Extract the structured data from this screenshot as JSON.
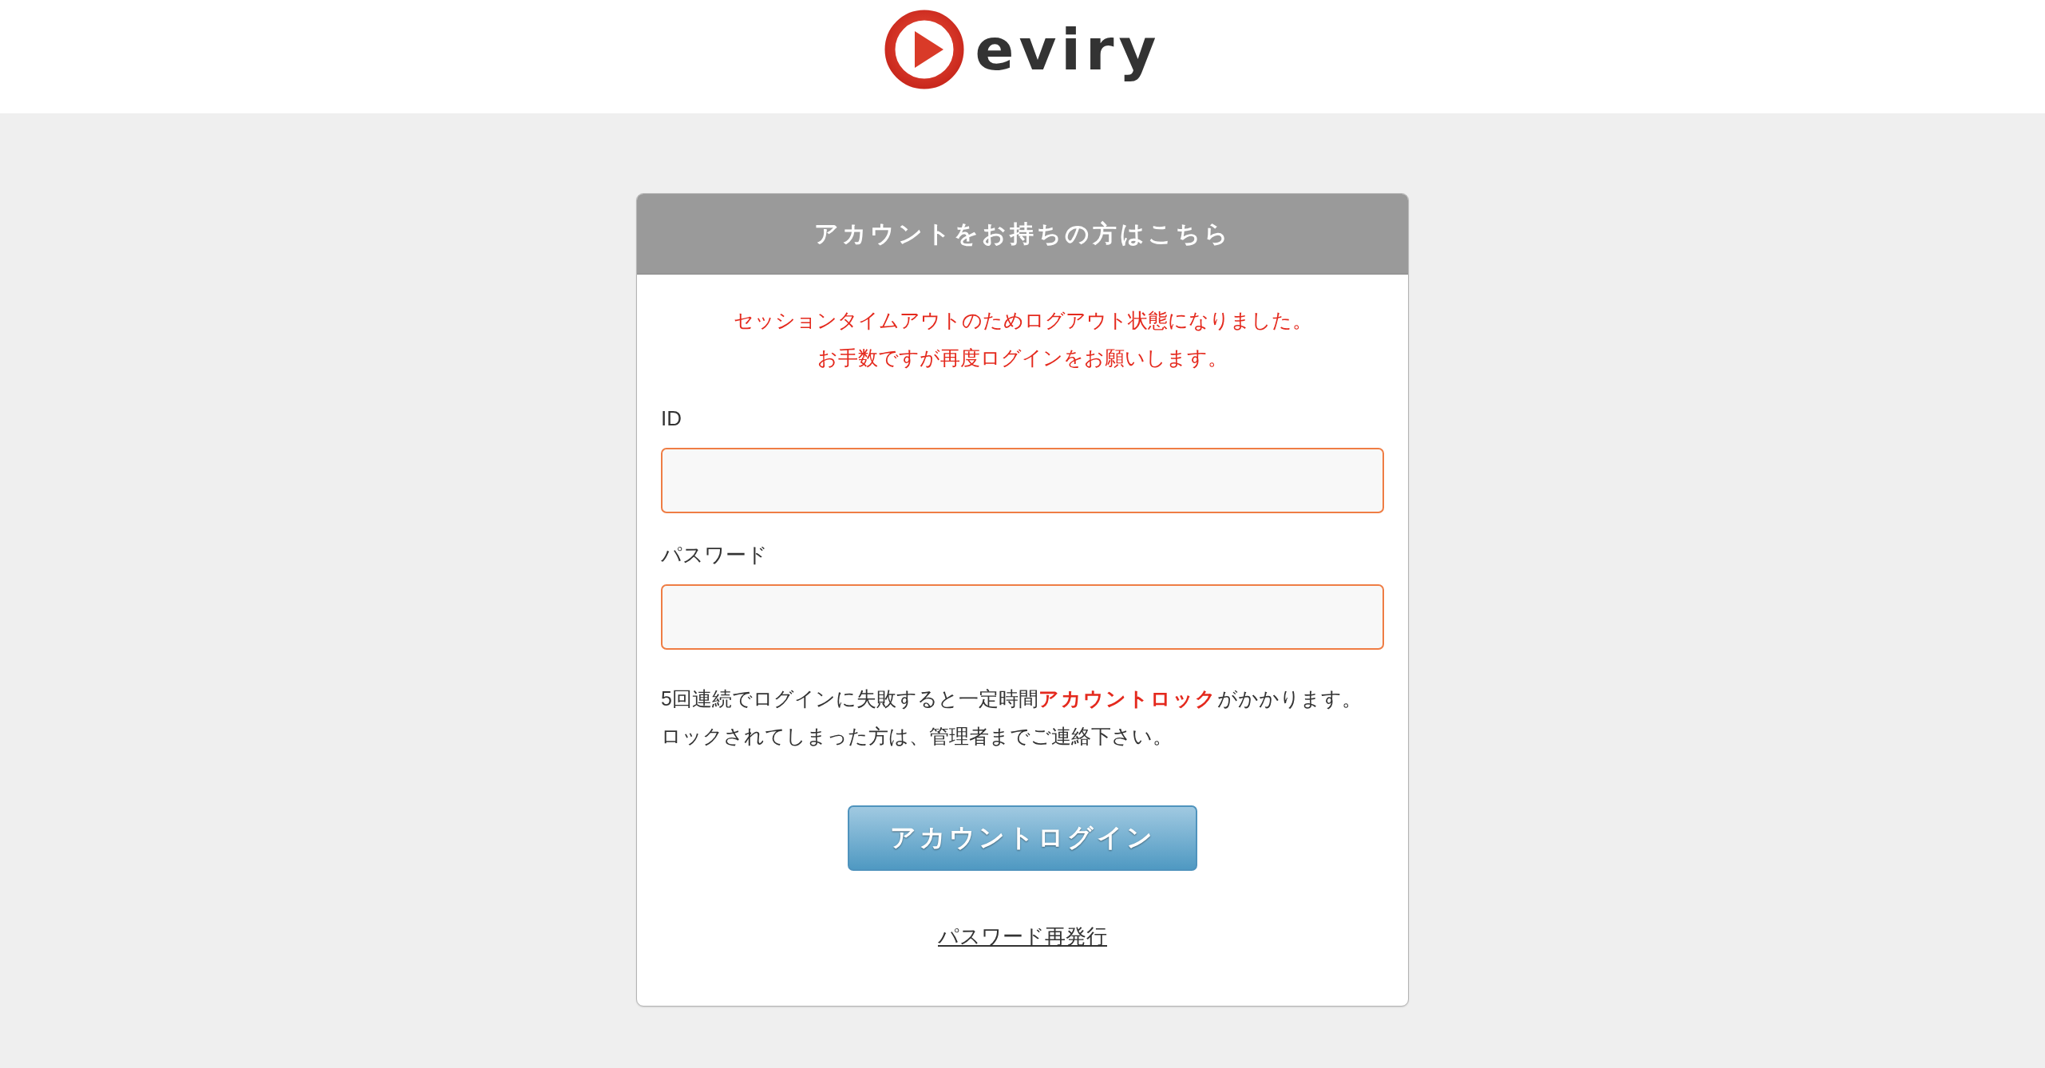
{
  "header": {
    "logo_text": "eviry"
  },
  "login_card": {
    "title": "アカウントをお持ちの方はこちら",
    "alert_lines": [
      "セッションタイムアウトのためログアウト状態になりました。",
      "お手数ですが再度ログインをお願いします。"
    ],
    "fields": [
      {
        "label": "ID"
      },
      {
        "label": "パスワード"
      }
    ],
    "notice_lines": [
      "5回連続でログインに失敗すると一定時間**アカウントロック**がかかります。",
      "ロックされてしまった方は、管理者までご連絡下さい。"
    ],
    "login_button": "アカウントログイン",
    "reset_link": "パスワード再発行"
  }
}
